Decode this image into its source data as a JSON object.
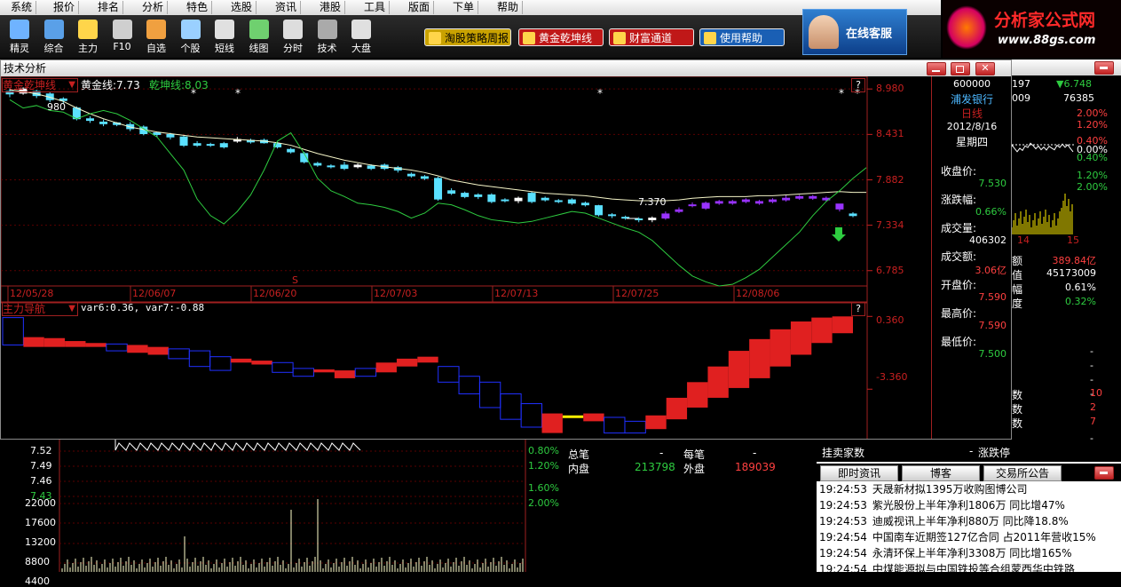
{
  "menu": [
    "系统",
    "报价",
    "排名",
    "分析",
    "特色",
    "选股",
    "资讯",
    "港股",
    "工具",
    "版面",
    "下单",
    "帮助"
  ],
  "toolbar": [
    "精灵",
    "综合",
    "主力",
    "F10",
    "自选",
    "个股",
    "短线",
    "线图",
    "分时",
    "技术",
    "大盘"
  ],
  "pills": [
    {
      "label": "淘股策略周报",
      "color": "#c9a200"
    },
    {
      "label": "黄金乾坤线",
      "color": "#c01818"
    },
    {
      "label": "财富通道",
      "color": "#c01818"
    },
    {
      "label": "使用帮助",
      "color": "#1a5fb4"
    }
  ],
  "service_banner": "在线客服",
  "logo": {
    "title": "分析家公式网",
    "url": "www.88gs.com"
  },
  "window": {
    "title": "技术分析"
  },
  "main_chart": {
    "indicator_name": "黄金乾坤线",
    "legend": [
      {
        "text": "黄金线:7.73",
        "color": "#ffffff"
      },
      {
        "text": "乾坤线:8.03",
        "color": "#2ecc40"
      }
    ],
    "yticks": [
      "8.980",
      "8.431",
      "7.882",
      "7.334",
      "6.785"
    ],
    "dates": [
      "12/05/28",
      "12/06/07",
      "12/06/20",
      "12/07/03",
      "12/07/13",
      "12/07/25",
      "12/08/06"
    ],
    "high_label": "980",
    "low_label": "7.370",
    "marker_s": "S",
    "question": "?"
  },
  "sub_chart": {
    "indicator_name": "主力导航",
    "legend": "var6:0.36, var7:-0.88",
    "yticks": [
      "0.360",
      "-3.360"
    ],
    "question": "?"
  },
  "info_panel": {
    "code": "600000",
    "name": "浦发银行",
    "period": "日线",
    "date": "2012/8/16",
    "weekday": "星期四",
    "items": [
      {
        "label": "收盘价:",
        "value": "7.530",
        "color": "#2ecc40"
      },
      {
        "label": "涨跌幅:",
        "value": "0.66%",
        "color": "#2ecc40"
      },
      {
        "label": "成交量:",
        "value": "406302",
        "color": "#ffffff"
      },
      {
        "label": "成交额:",
        "value": "3.06亿",
        "color": "#ff4040"
      },
      {
        "label": "开盘价:",
        "value": "7.590",
        "color": "#ff4040"
      },
      {
        "label": "最高价:",
        "value": "7.590",
        "color": "#ff4040"
      },
      {
        "label": "最低价:",
        "value": "7.500",
        "color": "#2ecc40"
      }
    ]
  },
  "right_quote": {
    "top1": "197",
    "top_price": "6.748",
    "top2": "009",
    "top3": "76385",
    "pcts": [
      "2.00%",
      "1.20%",
      "0.40%",
      "0.00%",
      "0.40%",
      "1.20%",
      "2.00%"
    ],
    "axis_labels": [
      "14",
      "15"
    ],
    "rows": [
      {
        "label": "额",
        "value": "389.84亿",
        "color": "#ff4040"
      },
      {
        "label": "值",
        "value": "45173009",
        "color": "#ffffff"
      },
      {
        "label": "幅",
        "value": "0.61%",
        "color": "#ffffff"
      },
      {
        "label": "度",
        "value": "0.32%",
        "color": "#2ecc40"
      }
    ],
    "dashes": [
      "-",
      "-",
      "-",
      "-"
    ],
    "counts": [
      {
        "label": "数",
        "value": "10"
      },
      {
        "label": "数",
        "value": "2"
      },
      {
        "label": "数",
        "value": "7"
      }
    ],
    "extra_dash": "-"
  },
  "bottom_left": {
    "prices": [
      "7.52",
      "7.49",
      "7.46",
      "7.43"
    ],
    "vols": [
      "22000",
      "17600",
      "13200",
      "8800",
      "4400"
    ],
    "pcts": [
      "0.80%",
      "1.20%",
      "1.60%",
      "2.00%"
    ]
  },
  "bottom_mid": {
    "r1": [
      {
        "t": "总笔",
        "c": "#ffffff"
      },
      {
        "t": "-",
        "c": "#ffffff"
      },
      {
        "t": "每笔",
        "c": "#ffffff"
      },
      {
        "t": "-",
        "c": "#ffffff"
      }
    ],
    "r2": [
      {
        "t": "内盘",
        "c": "#ffffff"
      },
      {
        "t": "213798",
        "c": "#2ecc40"
      },
      {
        "t": "外盘",
        "c": "#ffffff"
      },
      {
        "t": "189039",
        "c": "#ff4040"
      }
    ],
    "right": [
      {
        "t": "挂卖家数"
      },
      {
        "t": "-"
      },
      {
        "t": "涨跌停"
      }
    ]
  },
  "news": {
    "tabs": [
      "即时资讯",
      "博客",
      "交易所公告"
    ],
    "rows": [
      {
        "time": "19:24:53",
        "text": "天晟新材拟1395万收购图博公司"
      },
      {
        "time": "19:24:53",
        "text": "紫光股份上半年净利1806万 同比增47%"
      },
      {
        "time": "19:24:53",
        "text": "迪威视讯上半年净利880万 同比降18.8%"
      },
      {
        "time": "19:24:54",
        "text": "中国南车近期签127亿合同 占2011年营收15%"
      },
      {
        "time": "19:24:54",
        "text": "永清环保上半年净利3308万 同比增165%"
      },
      {
        "time": "19:24:54",
        "text": "中煤能源拟与中国铁投等合组蒙西华中铁路"
      }
    ]
  },
  "chart_data": {
    "type": "candlestick",
    "ylim": [
      6.6,
      9.1
    ],
    "candles": [
      {
        "o": 8.95,
        "c": 8.92,
        "h": 8.99,
        "l": 8.88
      },
      {
        "o": 8.93,
        "c": 8.98,
        "h": 9.0,
        "l": 8.91
      },
      {
        "o": 8.95,
        "c": 8.9,
        "h": 8.97,
        "l": 8.87
      },
      {
        "o": 8.92,
        "c": 8.85,
        "h": 8.94,
        "l": 8.82
      },
      {
        "o": 8.86,
        "c": 8.84,
        "h": 8.88,
        "l": 8.8
      },
      {
        "o": 8.75,
        "c": 8.62,
        "h": 8.77,
        "l": 8.6
      },
      {
        "o": 8.62,
        "c": 8.6,
        "h": 8.65,
        "l": 8.57
      },
      {
        "o": 8.58,
        "c": 8.56,
        "h": 8.61,
        "l": 8.53
      },
      {
        "o": 8.57,
        "c": 8.55,
        "h": 8.58,
        "l": 8.53
      },
      {
        "o": 8.55,
        "c": 8.5,
        "h": 8.58,
        "l": 8.47
      },
      {
        "o": 8.52,
        "c": 8.44,
        "h": 8.54,
        "l": 8.42
      },
      {
        "o": 8.45,
        "c": 8.43,
        "h": 8.46,
        "l": 8.4
      },
      {
        "o": 8.43,
        "c": 8.4,
        "h": 8.45,
        "l": 8.37
      },
      {
        "o": 8.4,
        "c": 8.3,
        "h": 8.42,
        "l": 8.28
      },
      {
        "o": 8.32,
        "c": 8.3,
        "h": 8.35,
        "l": 8.28
      },
      {
        "o": 8.31,
        "c": 8.3,
        "h": 8.33,
        "l": 8.28
      },
      {
        "o": 8.32,
        "c": 8.28,
        "h": 8.34,
        "l": 8.26
      },
      {
        "o": 8.35,
        "c": 8.37,
        "h": 8.4,
        "l": 8.33
      },
      {
        "o": 8.36,
        "c": 8.34,
        "h": 8.38,
        "l": 8.32
      },
      {
        "o": 8.36,
        "c": 8.33,
        "h": 8.38,
        "l": 8.32
      },
      {
        "o": 8.32,
        "c": 8.28,
        "h": 8.34,
        "l": 8.26
      },
      {
        "o": 8.25,
        "c": 8.22,
        "h": 8.27,
        "l": 8.2
      },
      {
        "o": 8.2,
        "c": 8.1,
        "h": 8.22,
        "l": 8.08
      },
      {
        "o": 8.08,
        "c": 8.06,
        "h": 8.1,
        "l": 8.04
      },
      {
        "o": 8.05,
        "c": 8.04,
        "h": 8.07,
        "l": 8.02
      },
      {
        "o": 8.06,
        "c": 8.02,
        "h": 8.1,
        "l": 8.0
      },
      {
        "o": 8.04,
        "c": 8.06,
        "h": 8.08,
        "l": 8.02
      },
      {
        "o": 8.05,
        "c": 8.02,
        "h": 8.07,
        "l": 8.0
      },
      {
        "o": 8.06,
        "c": 8.02,
        "h": 8.08,
        "l": 8.0
      },
      {
        "o": 8.03,
        "c": 8.0,
        "h": 8.05,
        "l": 7.97
      },
      {
        "o": 7.95,
        "c": 7.93,
        "h": 7.97,
        "l": 7.91
      },
      {
        "o": 7.92,
        "c": 7.9,
        "h": 7.94,
        "l": 7.88
      },
      {
        "o": 7.9,
        "c": 7.65,
        "h": 7.92,
        "l": 7.63
      },
      {
        "o": 7.75,
        "c": 7.72,
        "h": 7.78,
        "l": 7.7
      },
      {
        "o": 7.72,
        "c": 7.68,
        "h": 7.74,
        "l": 7.66
      },
      {
        "o": 7.7,
        "c": 7.68,
        "h": 7.72,
        "l": 7.65
      },
      {
        "o": 7.7,
        "c": 7.62,
        "h": 7.72,
        "l": 7.6
      },
      {
        "o": 7.64,
        "c": 7.63,
        "h": 7.66,
        "l": 7.61
      },
      {
        "o": 7.63,
        "c": 7.66,
        "h": 7.68,
        "l": 7.6
      },
      {
        "o": 7.72,
        "c": 7.62,
        "h": 7.74,
        "l": 7.6
      },
      {
        "o": 7.66,
        "c": 7.64,
        "h": 7.68,
        "l": 7.62
      },
      {
        "o": 7.63,
        "c": 7.62,
        "h": 7.65,
        "l": 7.6
      },
      {
        "o": 7.64,
        "c": 7.6,
        "h": 7.66,
        "l": 7.58
      },
      {
        "o": 7.6,
        "c": 7.58,
        "h": 7.62,
        "l": 7.56
      },
      {
        "o": 7.57,
        "c": 7.46,
        "h": 7.58,
        "l": 7.44
      },
      {
        "o": 7.46,
        "c": 7.45,
        "h": 7.48,
        "l": 7.42
      },
      {
        "o": 7.43,
        "c": 7.42,
        "h": 7.45,
        "l": 7.4
      },
      {
        "o": 7.41,
        "c": 7.4,
        "h": 7.43,
        "l": 7.37
      },
      {
        "o": 7.4,
        "c": 7.42,
        "h": 7.44,
        "l": 7.37
      },
      {
        "o": 7.42,
        "c": 7.47,
        "h": 7.5,
        "l": 7.4
      },
      {
        "o": 7.5,
        "c": 7.52,
        "h": 7.55,
        "l": 7.48
      },
      {
        "o": 7.58,
        "c": 7.58,
        "h": 7.61,
        "l": 7.55
      },
      {
        "o": 7.54,
        "c": 7.6,
        "h": 7.62,
        "l": 7.52
      },
      {
        "o": 7.6,
        "c": 7.62,
        "h": 7.64,
        "l": 7.58
      },
      {
        "o": 7.62,
        "c": 7.6,
        "h": 7.64,
        "l": 7.58
      },
      {
        "o": 7.62,
        "c": 7.64,
        "h": 7.66,
        "l": 7.6
      },
      {
        "o": 7.62,
        "c": 7.6,
        "h": 7.64,
        "l": 7.58
      },
      {
        "o": 7.64,
        "c": 7.62,
        "h": 7.66,
        "l": 7.6
      },
      {
        "o": 7.64,
        "c": 7.66,
        "h": 7.7,
        "l": 7.62
      },
      {
        "o": 7.66,
        "c": 7.68,
        "h": 7.7,
        "l": 7.64
      },
      {
        "o": 7.68,
        "c": 7.66,
        "h": 7.7,
        "l": 7.64
      },
      {
        "o": 7.66,
        "c": 7.64,
        "h": 7.68,
        "l": 7.62
      },
      {
        "o": 7.59,
        "c": 7.53,
        "h": 7.59,
        "l": 7.5
      },
      {
        "o": 7.47,
        "c": 7.45,
        "h": 7.49,
        "l": 7.43
      }
    ],
    "gold_line": [
      8.97,
      8.95,
      8.92,
      8.88,
      8.83,
      8.75,
      8.68,
      8.62,
      8.57,
      8.52,
      8.49,
      8.46,
      8.44,
      8.42,
      8.4,
      8.39,
      8.38,
      8.37,
      8.36,
      8.35,
      8.33,
      8.3,
      8.25,
      8.2,
      8.16,
      8.12,
      8.09,
      8.06,
      8.04,
      8.02,
      8.0,
      7.97,
      7.93,
      7.88,
      7.85,
      7.82,
      7.8,
      7.78,
      7.76,
      7.74,
      7.72,
      7.71,
      7.7,
      7.69,
      7.67,
      7.65,
      7.64,
      7.63,
      7.63,
      7.63,
      7.64,
      7.66,
      7.67,
      7.68,
      7.68,
      7.68,
      7.69,
      7.69,
      7.7,
      7.71,
      7.72,
      7.73,
      7.74,
      7.73,
      7.73
    ],
    "qian_line": [
      8.85,
      8.75,
      8.78,
      8.72,
      8.7,
      8.62,
      8.68,
      8.72,
      8.68,
      8.6,
      8.5,
      8.4,
      8.2,
      8.0,
      7.65,
      7.45,
      7.35,
      7.5,
      7.7,
      8.0,
      8.35,
      8.45,
      8.2,
      7.9,
      7.75,
      7.68,
      7.6,
      7.58,
      7.55,
      7.5,
      7.42,
      7.48,
      7.6,
      7.58,
      7.52,
      7.45,
      7.4,
      7.38,
      7.36,
      7.38,
      7.42,
      7.46,
      7.5,
      7.48,
      7.42,
      7.36,
      7.3,
      7.25,
      7.15,
      7.0,
      6.85,
      6.72,
      6.65,
      6.6,
      6.62,
      6.7,
      6.8,
      6.95,
      7.1,
      7.25,
      7.45,
      7.62,
      7.75,
      7.9,
      8.03
    ],
    "sub_series": [
      {
        "top": 0.3,
        "bot": -1.1,
        "color": "blue"
      },
      {
        "top": -0.7,
        "bot": -1.2,
        "color": "red"
      },
      {
        "top": -0.75,
        "bot": -1.2,
        "color": "red"
      },
      {
        "top": -0.9,
        "bot": -1.2,
        "color": "red"
      },
      {
        "top": -1.0,
        "bot": -1.2,
        "color": "red"
      },
      {
        "top": -1.05,
        "bot": -1.4,
        "color": "blue"
      },
      {
        "top": -1.1,
        "bot": -1.5,
        "color": "red"
      },
      {
        "top": -1.2,
        "bot": -1.6,
        "color": "red"
      },
      {
        "top": -1.3,
        "bot": -1.8,
        "color": "blue"
      },
      {
        "top": -1.4,
        "bot": -2.2,
        "color": "blue"
      },
      {
        "top": -1.7,
        "bot": -2.4,
        "color": "blue"
      },
      {
        "top": -1.8,
        "bot": -2.0,
        "color": "red"
      },
      {
        "top": -1.9,
        "bot": -2.1,
        "color": "red"
      },
      {
        "top": -2.0,
        "bot": -2.5,
        "color": "blue"
      },
      {
        "top": -2.3,
        "bot": -2.7,
        "color": "blue"
      },
      {
        "top": -2.35,
        "bot": -2.5,
        "color": "red"
      },
      {
        "top": -2.4,
        "bot": -2.8,
        "color": "red"
      },
      {
        "top": -2.3,
        "bot": -2.7,
        "color": "blue"
      },
      {
        "top": -2.0,
        "bot": -2.5,
        "color": "red"
      },
      {
        "top": -1.8,
        "bot": -2.2,
        "color": "red"
      },
      {
        "top": -1.7,
        "bot": -2.0,
        "color": "red"
      },
      {
        "top": -2.2,
        "bot": -3.0,
        "color": "blue"
      },
      {
        "top": -2.7,
        "bot": -3.6,
        "color": "blue"
      },
      {
        "top": -3.0,
        "bot": -4.3,
        "color": "blue"
      },
      {
        "top": -3.6,
        "bot": -4.9,
        "color": "blue"
      },
      {
        "top": -4.1,
        "bot": -5.3,
        "color": "blue"
      },
      {
        "top": -4.6,
        "bot": -5.6,
        "color": "red"
      },
      {
        "top": -4.7,
        "bot": -4.9,
        "color": "yellow"
      },
      {
        "top": -4.6,
        "bot": -5.0,
        "color": "red"
      },
      {
        "top": -4.8,
        "bot": -5.6,
        "color": "blue"
      },
      {
        "top": -5.0,
        "bot": -5.6,
        "color": "blue"
      },
      {
        "top": -4.7,
        "bot": -5.4,
        "color": "red"
      },
      {
        "top": -3.8,
        "bot": -4.9,
        "color": "red"
      },
      {
        "top": -3.0,
        "bot": -4.3,
        "color": "red"
      },
      {
        "top": -2.2,
        "bot": -3.8,
        "color": "red"
      },
      {
        "top": -1.4,
        "bot": -3.3,
        "color": "red"
      },
      {
        "top": -0.8,
        "bot": -2.8,
        "color": "red"
      },
      {
        "top": -0.3,
        "bot": -2.2,
        "color": "red"
      },
      {
        "top": 0.1,
        "bot": -1.6,
        "color": "red"
      },
      {
        "top": 0.3,
        "bot": -1.0,
        "color": "red"
      },
      {
        "top": 0.36,
        "bot": -0.5,
        "color": "red"
      }
    ],
    "sub_ylim": [
      -5.8,
      0.6
    ]
  }
}
